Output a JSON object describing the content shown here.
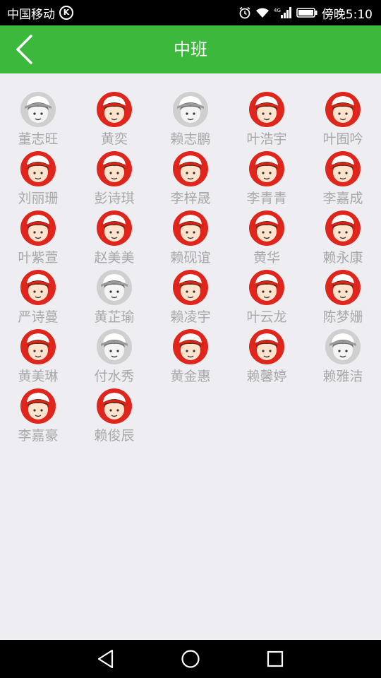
{
  "status_bar": {
    "carrier": "中国移动",
    "carrier_badge": "K",
    "network": "4G",
    "time": "傍晚5:10",
    "icons": [
      "alarm-icon",
      "wifi-icon",
      "signal-icon",
      "battery-icon"
    ]
  },
  "header": {
    "title": "中班",
    "back_icon": "chevron-left-icon",
    "bg_color": "#3CB83C"
  },
  "colors": {
    "active_avatar": "#E0261C",
    "inactive_avatar": "#CFCFCF",
    "name_text": "#A8A8A8",
    "page_bg": "#EEEEF2"
  },
  "students": [
    {
      "name": "董志旺",
      "active": false
    },
    {
      "name": "黄奕",
      "active": true
    },
    {
      "name": "赖志鹏",
      "active": false
    },
    {
      "name": "叶浩宇",
      "active": true
    },
    {
      "name": "叶囿吟",
      "active": true
    },
    {
      "name": "刘丽珊",
      "active": true
    },
    {
      "name": "彭诗琪",
      "active": true
    },
    {
      "name": "李梓晟",
      "active": true
    },
    {
      "name": "李青青",
      "active": true
    },
    {
      "name": "李嘉成",
      "active": true
    },
    {
      "name": "叶紫萱",
      "active": true
    },
    {
      "name": "赵美美",
      "active": true
    },
    {
      "name": "赖砚谊",
      "active": true
    },
    {
      "name": "黄华",
      "active": true
    },
    {
      "name": "赖永康",
      "active": true
    },
    {
      "name": "严诗蔓",
      "active": true
    },
    {
      "name": "黄芷瑜",
      "active": false
    },
    {
      "name": "赖凌宇",
      "active": true
    },
    {
      "name": "叶云龙",
      "active": true
    },
    {
      "name": "陈梦姗",
      "active": true
    },
    {
      "name": "黄美琳",
      "active": true
    },
    {
      "name": "付水秀",
      "active": false
    },
    {
      "name": "黄金惠",
      "active": true
    },
    {
      "name": "赖馨婷",
      "active": true
    },
    {
      "name": "赖雅洁",
      "active": false
    },
    {
      "name": "李嘉豪",
      "active": true
    },
    {
      "name": "赖俊辰",
      "active": true
    }
  ],
  "nav_bar": {
    "buttons": [
      "back-triangle-icon",
      "home-circle-icon",
      "recents-square-icon"
    ]
  }
}
